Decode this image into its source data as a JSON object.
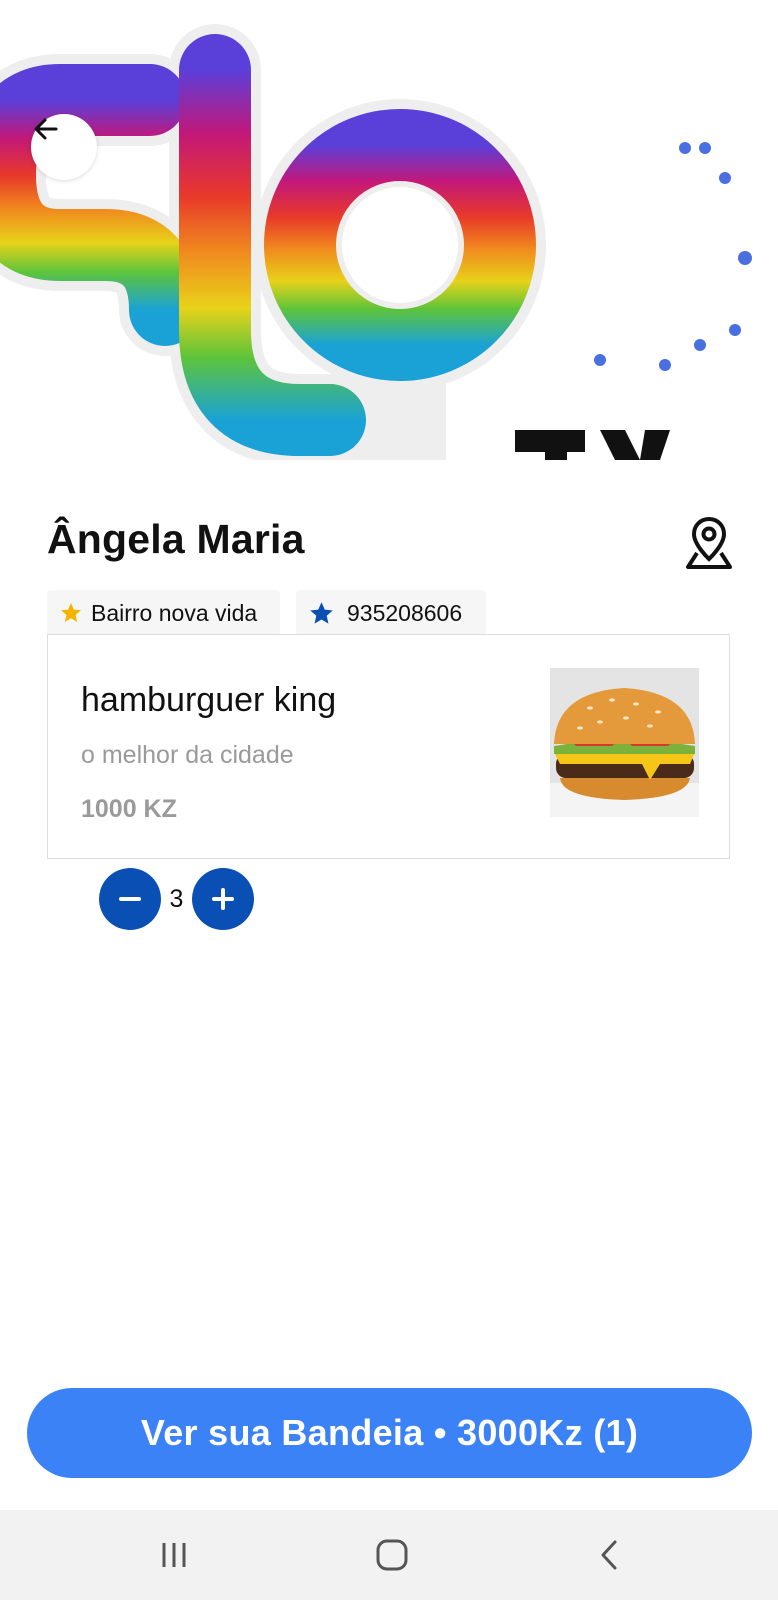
{
  "store": {
    "name": "Ângela Maria",
    "address": "Bairro nova vida",
    "phone": "935208606"
  },
  "product": {
    "name": "hamburguer king",
    "description": "o melhor da cidade",
    "price": "1000 KZ",
    "quantity": "3"
  },
  "cart": {
    "label": "Ver sua Bandeia • 3000Kz (1)"
  },
  "icons": {
    "back": "arrow-left-icon",
    "map": "map-pin-icon",
    "address": "star-icon",
    "phone": "star-icon",
    "minus": "minus-icon",
    "plus": "plus-icon",
    "nav_recents": "recents-icon",
    "nav_home": "home-icon",
    "nav_back": "back-chevron-icon"
  },
  "colors": {
    "primary_blue": "#0a4fb3",
    "cart_button": "#3b82f6",
    "address_star": "#f5b400",
    "phone_star": "#0a4fb3"
  }
}
